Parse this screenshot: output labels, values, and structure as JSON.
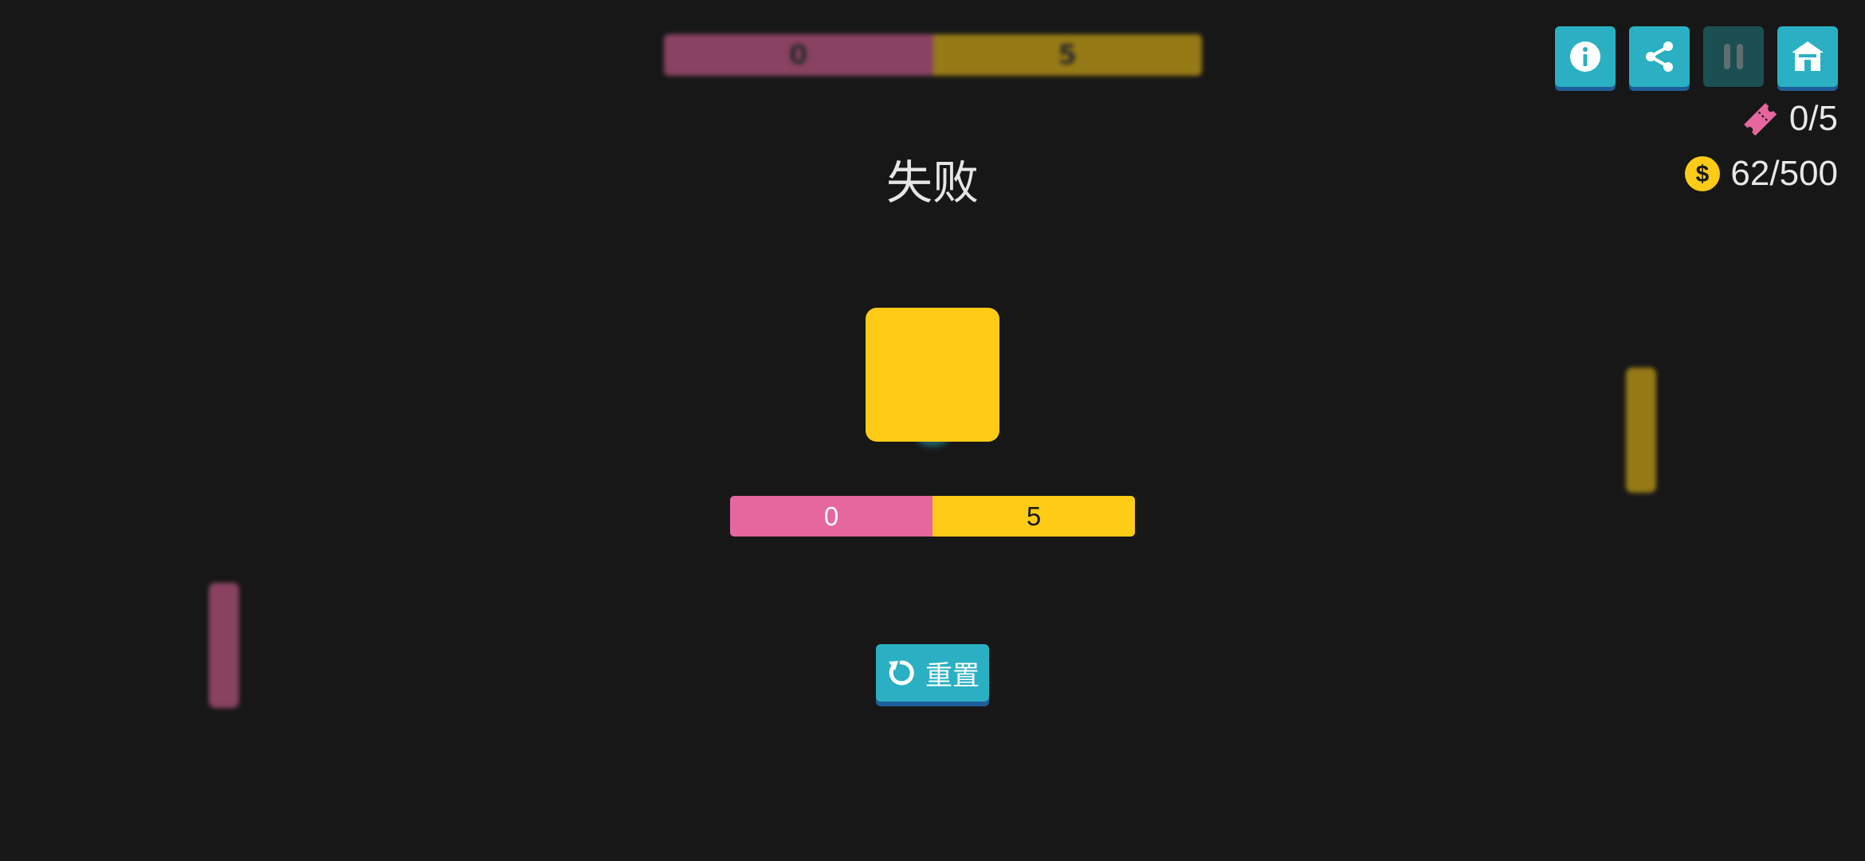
{
  "colors": {
    "background": "#171717",
    "pink": "#e6669e",
    "yellow": "#fecb16",
    "teal": "#2ab0c2",
    "teal_dark": "#1b4f52",
    "button_shadow": "#1d5f9a",
    "text": "#e8e8e8"
  },
  "header": {
    "buttons": [
      {
        "name": "info",
        "icon": "info-icon"
      },
      {
        "name": "share",
        "icon": "share-icon"
      },
      {
        "name": "pause",
        "icon": "pause-icon",
        "disabled": true
      },
      {
        "name": "home",
        "icon": "home-icon"
      }
    ],
    "tickets": {
      "icon": "ticket-icon",
      "value": "0/5"
    },
    "coins": {
      "icon": "coin-icon",
      "value": "62/500",
      "symbol": "$"
    }
  },
  "result": {
    "title": "失败"
  },
  "score": {
    "pink": "0",
    "yellow": "5"
  },
  "background_score": {
    "pink": "0",
    "yellow": "5"
  },
  "reset": {
    "label": "重置",
    "icon": "reset-icon"
  }
}
